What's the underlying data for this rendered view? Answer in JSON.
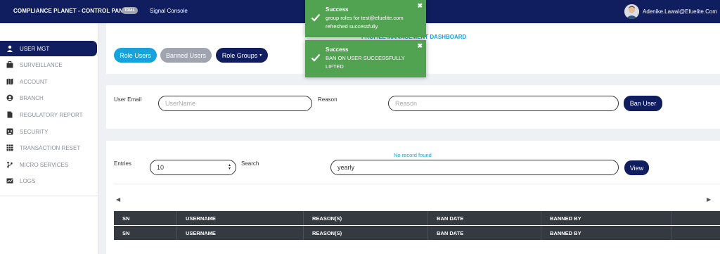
{
  "header": {
    "brand": "COMPLIANCE PLANET - CONTROL PANEL",
    "badge": "TRIAL",
    "app_name": "Signal Console",
    "user_email": "Adenike.Lawal@Efuelite.Com"
  },
  "sidebar": {
    "items": [
      {
        "label": "USER MGT",
        "icon": "user-icon"
      },
      {
        "label": "SURVEILLANCE",
        "icon": "briefcase-icon"
      },
      {
        "label": "ACCOUNT",
        "icon": "map-icon"
      },
      {
        "label": "BRANCH",
        "icon": "user-circle-icon"
      },
      {
        "label": "REGULATORY REPORT",
        "icon": "file-icon"
      },
      {
        "label": "SECURITY",
        "icon": "shield-icon"
      },
      {
        "label": "TRANSACTION RESET",
        "icon": "table-icon"
      },
      {
        "label": "MICRO SERVICES",
        "icon": "branch-icon"
      },
      {
        "label": "LOGS",
        "icon": "chart-icon"
      }
    ]
  },
  "top_card": {
    "heading": "PROFILE MANAGEMENT DASHBOARD",
    "buttons": {
      "role_users": "Role Users",
      "banned_users": "Banned Users",
      "role_groups": "Role Groups"
    }
  },
  "ban_form": {
    "email_label": "User Email",
    "email_placeholder": "UserName",
    "reason_label": "Reason",
    "reason_placeholder": "Reason",
    "submit_label": "Ban User"
  },
  "list": {
    "entries_label": "Entries",
    "entries_value": "10",
    "search_label": "Search",
    "search_value": "yearly",
    "status": "No record found",
    "view_label": "View",
    "columns": [
      "SN",
      "USERNAME",
      "REASON(S)",
      "BAN DATE",
      "BANNED BY"
    ]
  },
  "toasts": [
    {
      "title": "Success",
      "message": "group roles for test@efuelite.com refreshed successfully."
    },
    {
      "title": "Success",
      "message": "BAN ON USER SUCCESSFULLY LIFTED"
    }
  ],
  "colors": {
    "navy": "#101d5e",
    "accent": "#17a2dc",
    "success": "#51a351",
    "table_head": "#343a40"
  }
}
